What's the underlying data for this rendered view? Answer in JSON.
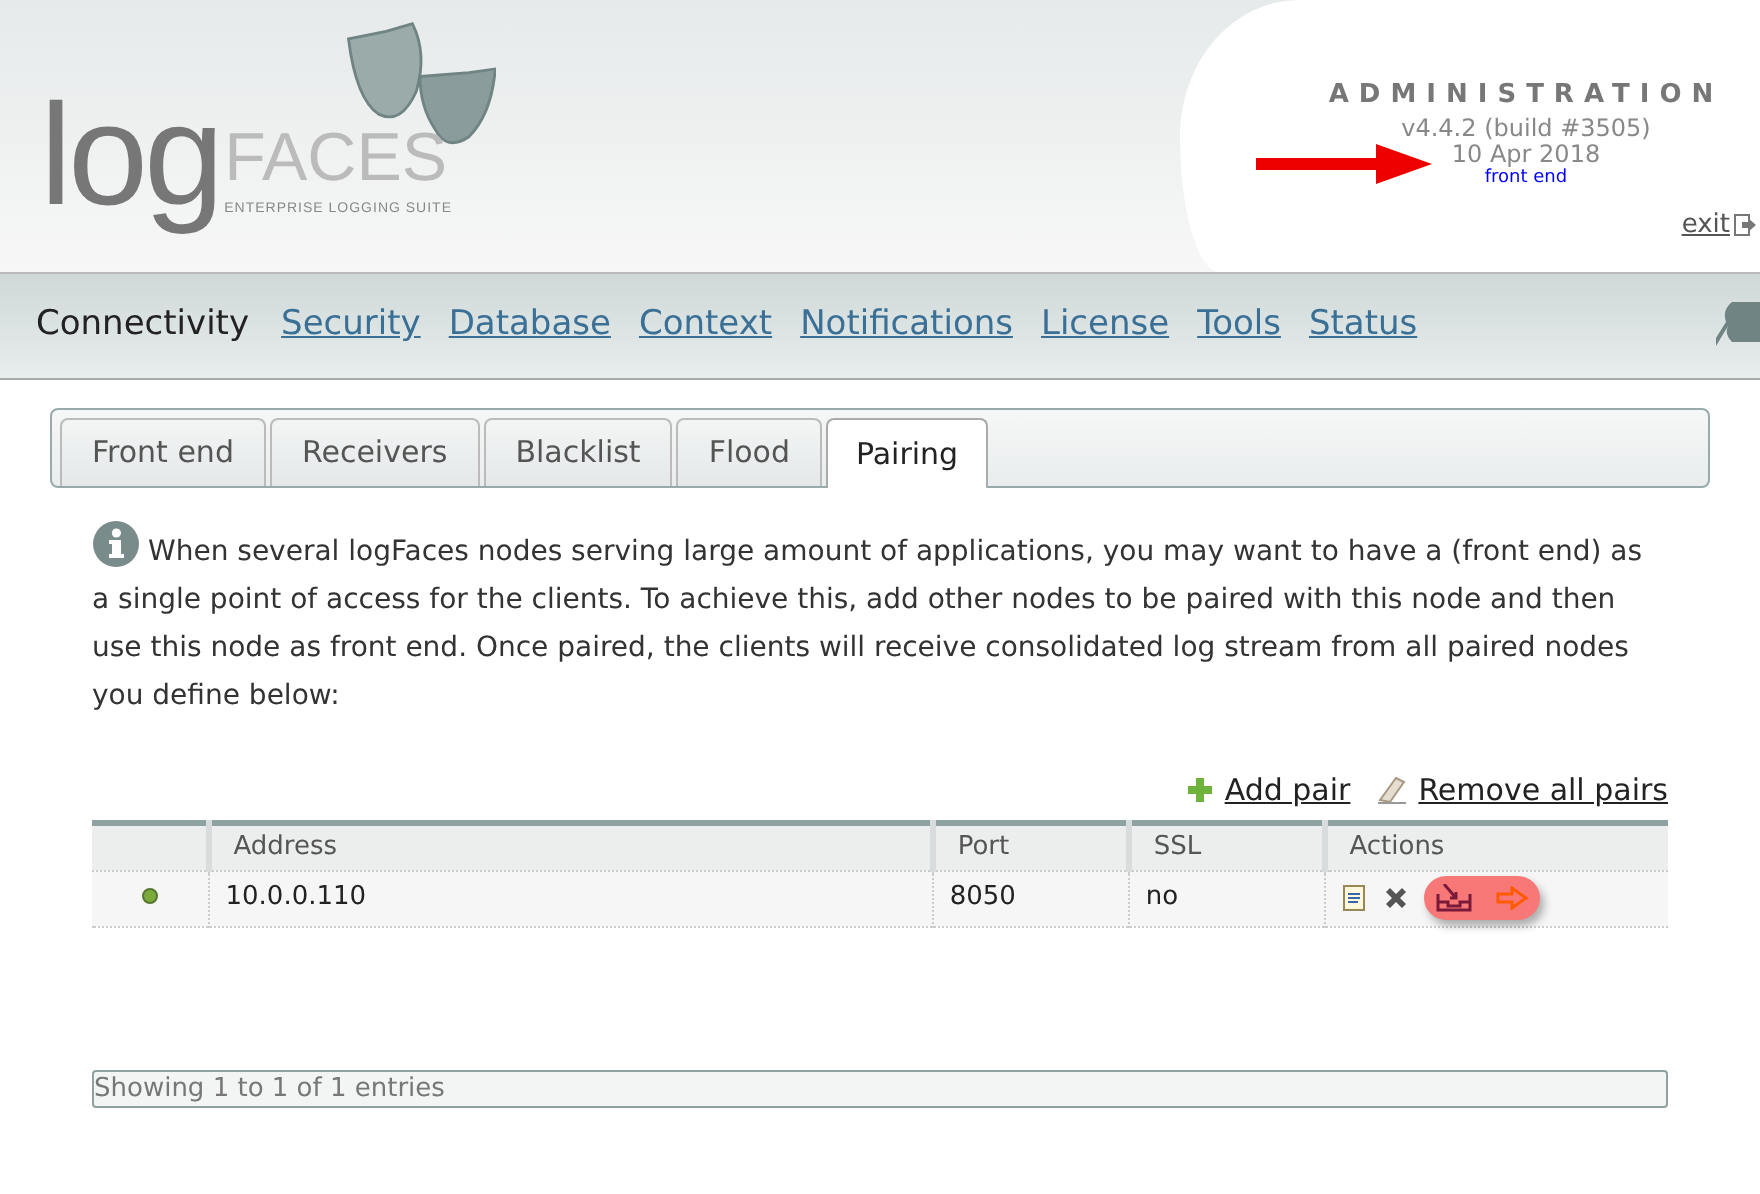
{
  "logo": {
    "word_main": "log",
    "word_accent": "FACES",
    "tagline": "ENTERPRISE LOGGING SUITE"
  },
  "header": {
    "title": "ADMINISTRATION",
    "version": "v4.4.2 (build #3505)",
    "date": "10 Apr 2018",
    "mode": "front end",
    "exit": "exit"
  },
  "nav": [
    {
      "label": "Connectivity",
      "selected": true
    },
    {
      "label": "Security",
      "selected": false
    },
    {
      "label": "Database",
      "selected": false
    },
    {
      "label": "Context",
      "selected": false
    },
    {
      "label": "Notifications",
      "selected": false
    },
    {
      "label": "License",
      "selected": false
    },
    {
      "label": "Tools",
      "selected": false
    },
    {
      "label": "Status",
      "selected": false
    }
  ],
  "tabs": [
    {
      "label": "Front end",
      "selected": false
    },
    {
      "label": "Receivers",
      "selected": false
    },
    {
      "label": "Blacklist",
      "selected": false
    },
    {
      "label": "Flood",
      "selected": false
    },
    {
      "label": "Pairing",
      "selected": true
    }
  ],
  "info": "When several logFaces nodes serving large amount of applications, you may want to have a (front end) as a single point of access for the clients. To achieve this, add other nodes to be paired with this node and then use this node as front end. Once paired, the clients will receive consolidated log stream from all paired nodes you define below:",
  "toolbar": {
    "add": "Add pair",
    "remove_all": "Remove all pairs"
  },
  "table": {
    "columns": [
      "Address",
      "Port",
      "SSL",
      "Actions"
    ],
    "rows": [
      {
        "color": "#7cab3c",
        "address": "10.0.0.110",
        "port": "8050",
        "ssl": "no"
      }
    ]
  },
  "footer": "Showing 1 to 1 of 1 entries"
}
